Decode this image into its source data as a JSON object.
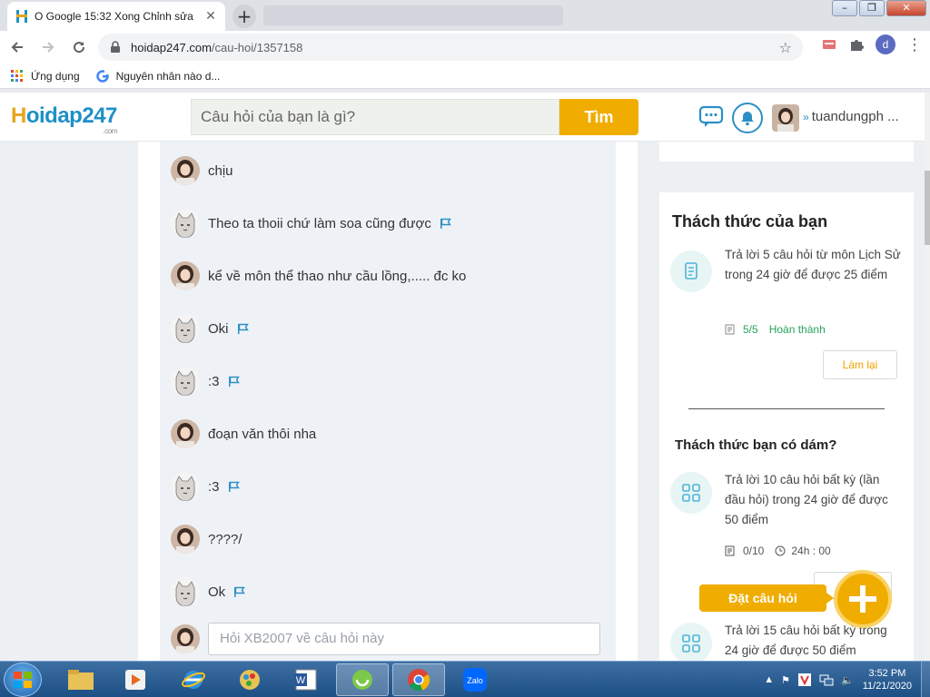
{
  "browser": {
    "tab_title": "O Google 15:32 Xong Chỉnh sửa",
    "tab_close": "✕",
    "new_tab": "+",
    "url_domain": "hoidap247.com",
    "url_path": "/cau-hoi/1357158",
    "profile_initial": "d",
    "bookmarks": [
      {
        "label": "Ứng dụng",
        "icon": "apps-grid-icon"
      },
      {
        "label": "Nguyên nhân nào d...",
        "icon": "google-icon"
      }
    ]
  },
  "header": {
    "logo_main": "oidap247",
    "logo_h": "H",
    "logo_sub": ".com",
    "search_placeholder": "Câu hỏi của bạn là gì?",
    "search_button": "Tìm",
    "username": "tuandungph ..."
  },
  "comments": [
    {
      "avatar": "girl",
      "text": "chịu",
      "flag": false
    },
    {
      "avatar": "cat",
      "text": "Theo ta thoii chứ làm soa cũng được",
      "flag": true
    },
    {
      "avatar": "girl",
      "text": "kể về môn thể thao như cầu lồng,..... đc ko",
      "flag": false
    },
    {
      "avatar": "cat",
      "text": "Oki",
      "flag": true
    },
    {
      "avatar": "cat",
      "text": ":3",
      "flag": true
    },
    {
      "avatar": "girl",
      "text": "đoạn văn thôi nha",
      "flag": false
    },
    {
      "avatar": "cat",
      "text": ":3",
      "flag": true
    },
    {
      "avatar": "girl",
      "text": "????/",
      "flag": false
    },
    {
      "avatar": "cat",
      "text": "Ok",
      "flag": true
    }
  ],
  "reply_placeholder": "Hỏi XB2007 về câu hỏi này",
  "sidebar": {
    "challenge_title": "Thách thức của bạn",
    "challenge1": {
      "text": "Trả lời 5 câu hỏi  từ môn Lịch Sử  trong 24 giờ để được 25 điểm",
      "progress": "5/5",
      "status": "Hoàn thành",
      "button": "Làm lại"
    },
    "dare_title": "Thách thức bạn có dám?",
    "challenge2": {
      "text": "Trả lời 10 câu hỏi  bất kỳ (lần đầu hỏi) trong 24 giờ để được 50 điểm",
      "progress": "0/10",
      "time": "24h : 00"
    },
    "challenge3": {
      "text": "Trả lời 15 câu hỏi  bất kỳ trong 24 giờ để được 50 điểm"
    }
  },
  "fab_label": "Đặt câu hỏi",
  "taskbar": {
    "time": "3:52 PM",
    "date": "11/21/2020",
    "zalo": "Zalo"
  },
  "colors": {
    "accent_blue": "#1d90c7",
    "accent_orange": "#f0ad00",
    "success_green": "#27a35a"
  }
}
